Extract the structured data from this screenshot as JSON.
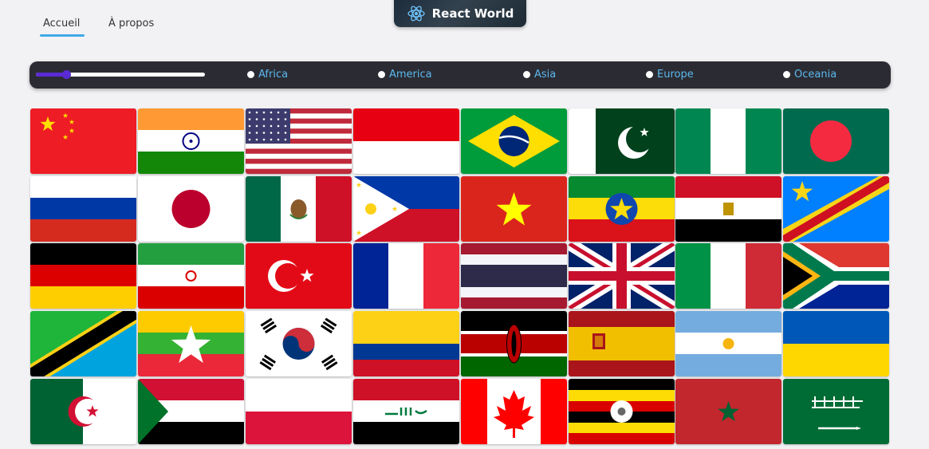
{
  "nav": {
    "tabs": [
      {
        "label": "Accueil",
        "active": true
      },
      {
        "label": "À propos",
        "active": false
      }
    ],
    "brand": "React World",
    "accent_color": "#3fa9e8"
  },
  "filters": {
    "slider_value": 0.18,
    "regions": [
      "Africa",
      "America",
      "Asia",
      "Europe",
      "Oceania"
    ],
    "label_color": "#5bb8ef",
    "slider_color": "#5a2bd4"
  },
  "flags": [
    "china",
    "india",
    "usa",
    "indonesia",
    "brazil",
    "pakistan",
    "nigeria",
    "bangladesh",
    "russia",
    "japan",
    "mexico",
    "philippines",
    "vietnam",
    "ethiopia",
    "egypt",
    "dr-congo",
    "germany",
    "iran",
    "turkey",
    "france",
    "thailand",
    "united-kingdom",
    "italy",
    "south-africa",
    "tanzania",
    "myanmar",
    "south-korea",
    "colombia",
    "kenya",
    "spain",
    "argentina",
    "ukraine",
    "algeria",
    "sudan",
    "poland",
    "iraq",
    "canada",
    "uganda",
    "morocco",
    "saudi-arabia"
  ]
}
